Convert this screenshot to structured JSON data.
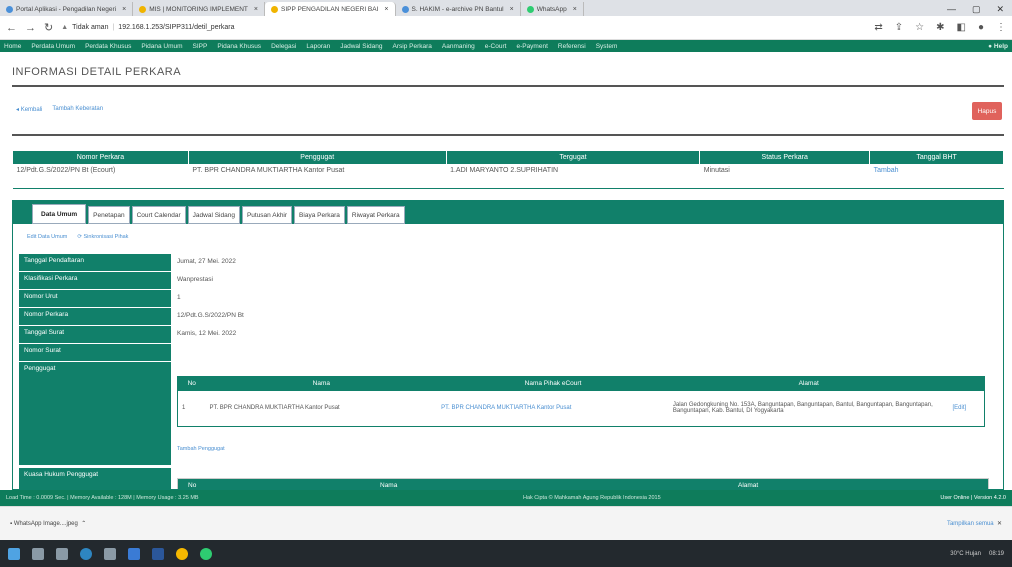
{
  "browser": {
    "tabs": [
      {
        "label": "Portal Aplikasi - Pengadilan Negeri",
        "active": false
      },
      {
        "label": "MIS | MONITORING IMPLEMENT",
        "active": false
      },
      {
        "label": "SIPP PENGADILAN NEGERI BAI",
        "active": true
      },
      {
        "label": "S. HAKIM - e-archive PN Bantul",
        "active": false
      },
      {
        "label": "WhatsApp",
        "active": false
      }
    ],
    "security": "Tidak aman",
    "url": "192.168.1.253/SIPP311/detil_perkara"
  },
  "menubar": {
    "items": [
      "Home",
      "Perdata Umum",
      "Perdata Khusus",
      "Pidana Umum",
      "SIPP",
      "Pidana Khusus",
      "Delegasi",
      "Laporan",
      "Jadwal Sidang",
      "Arsip Perkara",
      "Aanmaning",
      "e-Court",
      "e-Payment",
      "Referensi",
      "System"
    ],
    "help": "Help"
  },
  "page": {
    "title": "INFORMASI DETAIL PERKARA",
    "back_link": "Kembali",
    "add_info_link": "Tambah Keberatan",
    "delete_button": "Hapus"
  },
  "summary": {
    "headers": [
      "Nomor Perkara",
      "Penggugat",
      "Tergugat",
      "Status Perkara",
      "Tanggal BHT"
    ],
    "row": {
      "nomor": "12/Pdt.G.S/2022/PN Bt (Ecourt)",
      "penggugat": "PT. BPR CHANDRA MUKTIARTHA Kantor Pusat",
      "tergugat": "1.ADI MARYANTO 2.SUPRIHATIN",
      "status": "Minutasi",
      "bht": "Tambah"
    }
  },
  "tabs": [
    {
      "label": "Data Umum",
      "active": true
    },
    {
      "label": "Penetapan",
      "active": false
    },
    {
      "label": "Court Calendar",
      "active": false
    },
    {
      "label": "Jadwal Sidang",
      "active": false
    },
    {
      "label": "Putusan Akhir",
      "active": false
    },
    {
      "label": "Biaya Perkara",
      "active": false
    },
    {
      "label": "Riwayat Perkara",
      "active": false
    }
  ],
  "sublinks": {
    "edit": "Edit Data Umum",
    "sync": "Sinkronisasi Pihak"
  },
  "details": [
    {
      "label": "Tanggal Pendaftaran",
      "value": "Jumat, 27 Mei. 2022"
    },
    {
      "label": "Klasifikasi Perkara",
      "value": "Wanprestasi"
    },
    {
      "label": "Nomor Urut",
      "value": "1"
    },
    {
      "label": "Nomor Perkara",
      "value": "12/Pdt.G.S/2022/PN Bt"
    },
    {
      "label": "Tanggal Surat",
      "value": "Kamis, 12 Mei. 2022"
    },
    {
      "label": "Nomor Surat",
      "value": ""
    },
    {
      "label": "Penggugat",
      "value": ""
    },
    {
      "label": "Kuasa Hukum Penggugat",
      "value": ""
    }
  ],
  "parties": {
    "headers": [
      "No",
      "Nama",
      "Nama Pihak eCourt",
      "Alamat"
    ],
    "rows": [
      {
        "no": "1",
        "nama": "PT. BPR CHANDRA MUKTIARTHA Kantor Pusat",
        "nama_ecourt": "PT. BPR CHANDRA MUKTIARTHA Kantor Pusat",
        "alamat": "Jalan Gedongkuning No. 153A, Banguntapan, Banguntapan, Bantul, Banguntapan, Banguntapan, Banguntapan, Kab. Bantul, DI Yogyakarta",
        "action": "[Edit]"
      }
    ],
    "add_link": "Tambah Penggugat"
  },
  "kuasa": {
    "headers": [
      "No",
      "Nama",
      "Alamat"
    ]
  },
  "statusbar": {
    "left": "Load Time : 0.0009 Sec. | Memory Available : 128M | Memory Usage : 3.25 MB",
    "center": "Hak Cipta © Mahkamah Agung Republik Indonesia 2015",
    "right": "User Online | Version 4.2.0"
  },
  "download": {
    "file": "WhatsApp Image....jpeg",
    "show_all": "Tampilkan semua"
  },
  "taskbar": {
    "tray": "30°C Hujan",
    "time": "08:19"
  }
}
